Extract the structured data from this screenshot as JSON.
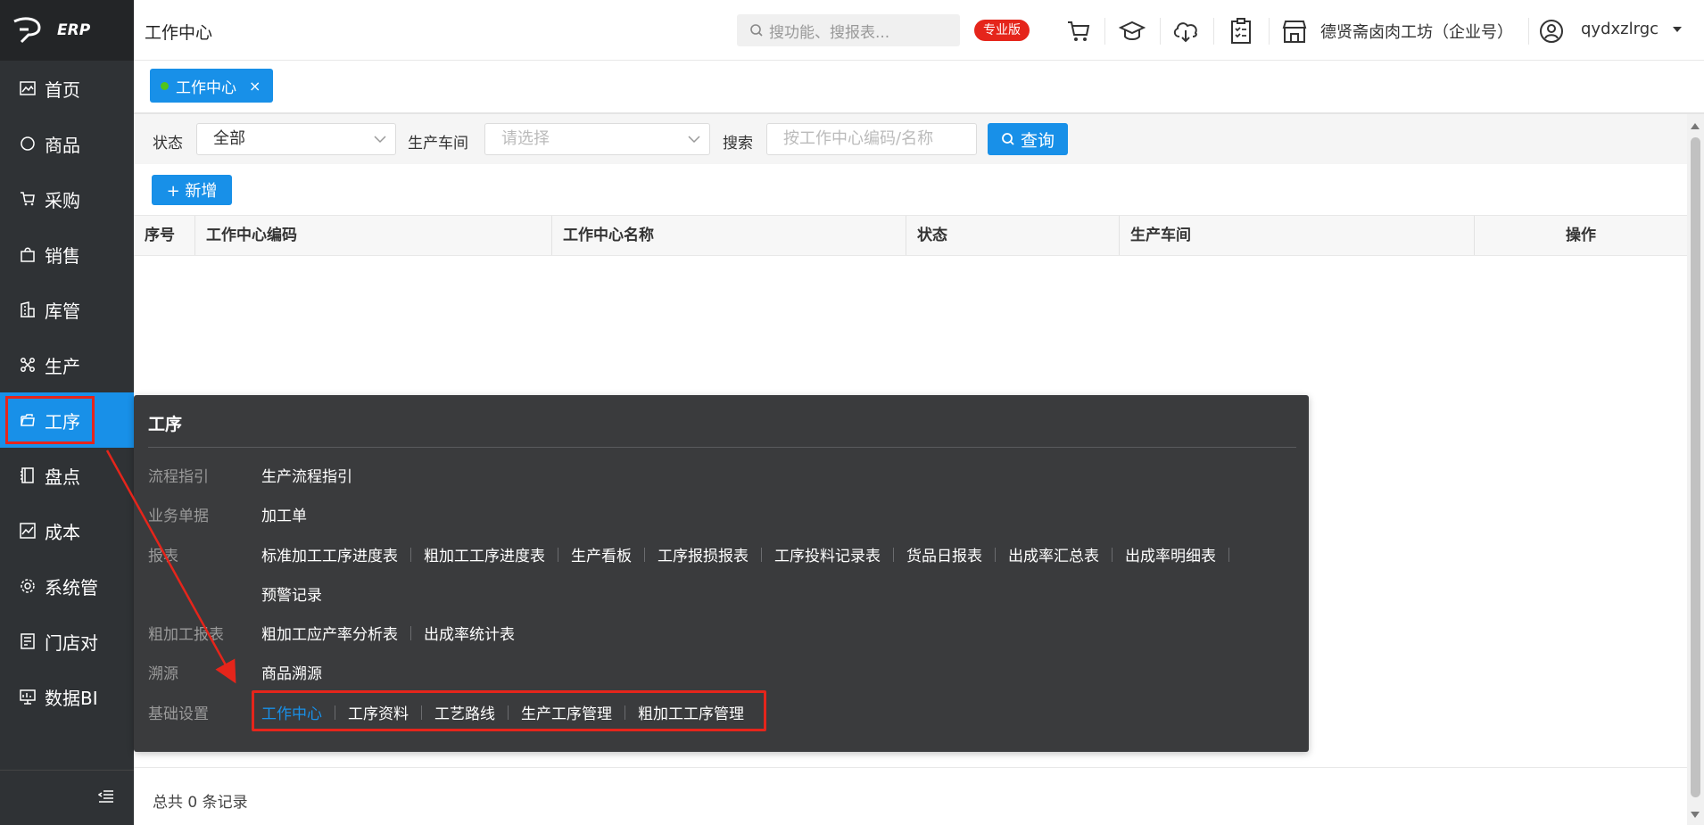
{
  "app": {
    "logo_text": "ERP"
  },
  "sidebar": {
    "items": [
      {
        "label": "首页",
        "icon": "image-icon"
      },
      {
        "label": "商品",
        "icon": "circle-icon"
      },
      {
        "label": "采购",
        "icon": "cart-icon"
      },
      {
        "label": "销售",
        "icon": "bag-icon"
      },
      {
        "label": "库管",
        "icon": "warehouse-icon"
      },
      {
        "label": "生产",
        "icon": "network-icon"
      },
      {
        "label": "工序",
        "icon": "folder-icon",
        "active": true
      },
      {
        "label": "盘点",
        "icon": "book-icon"
      },
      {
        "label": "成本",
        "icon": "chart-icon"
      },
      {
        "label": "系统管",
        "icon": "gear-icon"
      },
      {
        "label": "门店对",
        "icon": "receipt-icon"
      },
      {
        "label": "数据BI",
        "icon": "monitor-icon"
      }
    ],
    "collapse_icon": "menu-fold-icon"
  },
  "header": {
    "title": "工作中心",
    "search_placeholder": "搜功能、搜报表...",
    "badge": "专业版",
    "company": "德贤斋卤肉工坊（企业号）",
    "username": "qydxzlrgc"
  },
  "tabs": [
    {
      "label": "工作中心",
      "close": "×"
    }
  ],
  "filters": {
    "status_label": "状态",
    "status_value": "全部",
    "workshop_label": "生产车间",
    "workshop_placeholder": "请选择",
    "search_label": "搜索",
    "search_placeholder": "按工作中心编码/名称",
    "query_button": "查询"
  },
  "add_button": "+ 新增",
  "table": {
    "headers": [
      "序号",
      "工作中心编码",
      "工作中心名称",
      "状态",
      "生产车间",
      "操作"
    ],
    "rows": []
  },
  "footer": {
    "total_text": "总共 0 条记录"
  },
  "popup": {
    "title": "工序",
    "rows": [
      {
        "category": "流程指引",
        "links": [
          "生产流程指引"
        ]
      },
      {
        "category": "业务单据",
        "links": [
          "加工单"
        ]
      },
      {
        "category": "报表",
        "links": [
          "标准加工工序进度表",
          "粗加工工序进度表",
          "生产看板",
          "工序报损报表",
          "工序投料记录表",
          "货品日报表",
          "出成率汇总表",
          "出成率明细表"
        ]
      },
      {
        "category": "",
        "links": [
          "预警记录"
        ]
      },
      {
        "category": "粗加工报表",
        "links": [
          "粗加工应产率分析表",
          "出成率统计表"
        ]
      },
      {
        "category": "溯源",
        "links": [
          "商品溯源"
        ]
      },
      {
        "category": "基础设置",
        "links": [
          "工作中心",
          "工序资料",
          "工艺路线",
          "生产工序管理",
          "粗加工工序管理"
        ],
        "active_link": "工作中心"
      }
    ]
  },
  "colors": {
    "accent": "#1890e8",
    "sidebar_bg": "#2f3235",
    "popup_bg": "#3a3b3d",
    "highlight": "#e5251b",
    "badge": "#e5251b"
  }
}
